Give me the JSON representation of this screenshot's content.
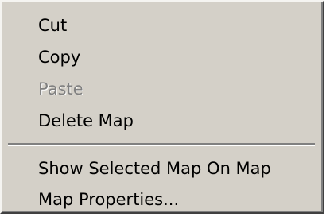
{
  "context_menu": {
    "items": [
      {
        "label": "Cut",
        "enabled": true
      },
      {
        "label": "Copy",
        "enabled": true
      },
      {
        "label": "Paste",
        "enabled": false
      },
      {
        "label": "Delete Map",
        "enabled": true
      },
      {
        "label": "Show Selected Map On Map",
        "enabled": true
      },
      {
        "label": "Map Properties...",
        "enabled": true
      }
    ],
    "colors": {
      "background": "#d4d0c8",
      "text": "#000000",
      "disabled_text": "#808080",
      "highlight_edge": "#ffffff",
      "shadow_edge": "#808080"
    }
  }
}
